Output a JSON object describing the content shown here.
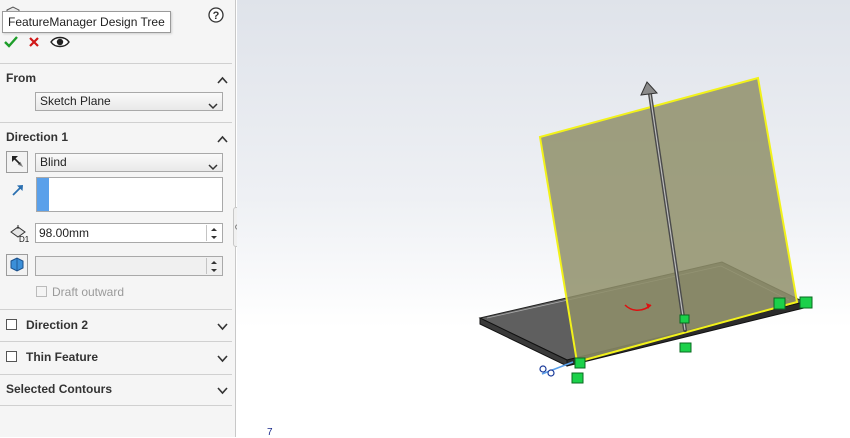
{
  "tooltip": {
    "text": "FeatureManager Design Tree"
  },
  "actions": {
    "ok": "check-icon",
    "cancel": "close-icon",
    "preview": "eye-icon"
  },
  "sections": {
    "from": {
      "title": "From",
      "start_condition": "Sketch Plane"
    },
    "direction1": {
      "title": "Direction 1",
      "end_condition": "Blind",
      "depth": "98.00mm",
      "draft_outward": "Draft outward"
    },
    "direction2": {
      "title": "Direction 2"
    },
    "thin_feature": {
      "title": "Thin Feature"
    },
    "selected_contours": {
      "title": "Selected Contours"
    }
  },
  "viewport": {
    "corner_label": "7"
  },
  "colors": {
    "plane_fill": "#8f8f6a",
    "plane_edge": "#f2f21a",
    "handle_green": "#1bd14a",
    "accent_blue": "#5aa0ea"
  }
}
